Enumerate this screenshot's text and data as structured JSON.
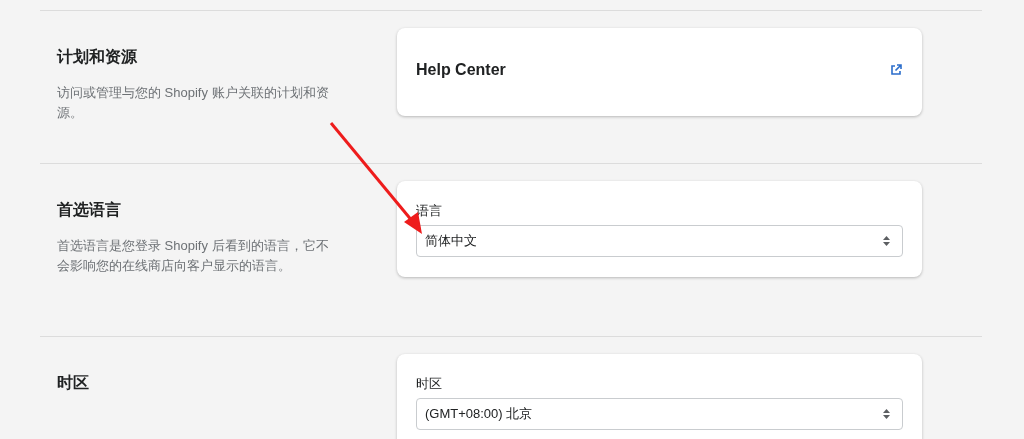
{
  "sections": [
    {
      "title": "计划和资源",
      "description": "访问或管理与您的 Shopify 账户关联的计划和资源。",
      "card": {
        "kind": "link",
        "label": "Help Center"
      }
    },
    {
      "title": "首选语言",
      "description": "首选语言是您登录 Shopify 后看到的语言，它不会影响您的在线商店向客户显示的语言。",
      "card": {
        "kind": "select",
        "label": "语言",
        "value": "简体中文"
      }
    },
    {
      "title": "时区",
      "card": {
        "kind": "select",
        "label": "时区",
        "value": "(GMT+08:00) 北京"
      }
    }
  ]
}
